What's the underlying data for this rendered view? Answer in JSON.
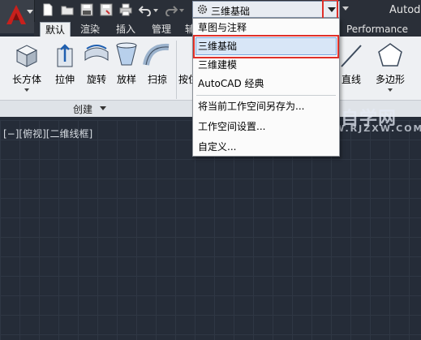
{
  "title_bar": {
    "app_title": "Autode",
    "workspace_combo": {
      "value": "三维基础"
    },
    "quick_access": [
      {
        "name": "new-icon"
      },
      {
        "name": "open-icon"
      },
      {
        "name": "save-icon"
      },
      {
        "name": "save-as-icon"
      },
      {
        "name": "print-icon"
      },
      {
        "name": "undo-icon"
      },
      {
        "name": "redo-icon"
      }
    ]
  },
  "ribbon": {
    "tabs": [
      {
        "label": "默认",
        "active": true
      },
      {
        "label": "渲染"
      },
      {
        "label": "插入"
      },
      {
        "label": "管理"
      },
      {
        "label": "辅"
      },
      {
        "label": "Performance"
      }
    ],
    "tools": [
      {
        "label": "长方体",
        "icon": "box-icon",
        "dropdown": true
      },
      {
        "label": "拉伸",
        "icon": "extrude-icon"
      },
      {
        "label": "旋转",
        "icon": "revolve-icon"
      },
      {
        "label": "放样",
        "icon": "loft-icon"
      },
      {
        "label": "扫掠",
        "icon": "sweep-icon"
      },
      {
        "label": "按住",
        "icon": "presspull-icon"
      },
      {
        "label": "直线",
        "icon": "line-icon"
      },
      {
        "label": "多边形",
        "icon": "polygon-icon",
        "dropdown": true
      }
    ],
    "panel_label": "创建"
  },
  "viewport": {
    "label": "[−][俯视][二维线框]"
  },
  "workspace_menu": {
    "items": [
      {
        "label": "草图与注释"
      },
      {
        "label": "三维基础",
        "selected": true
      },
      {
        "label": "三维建模"
      },
      {
        "label": "AutoCAD 经典"
      },
      {
        "label": "将当前工作空间另存为..."
      },
      {
        "label": "工作空间设置..."
      },
      {
        "label": "自定义..."
      }
    ]
  },
  "watermark": {
    "line1": "软件自学网",
    "line2": "WWW.RJZXW.COM"
  },
  "colors": {
    "highlight_red": "#e0302a",
    "selection_blue": "#d8e6f7",
    "viewport_bg": "#252c38"
  }
}
